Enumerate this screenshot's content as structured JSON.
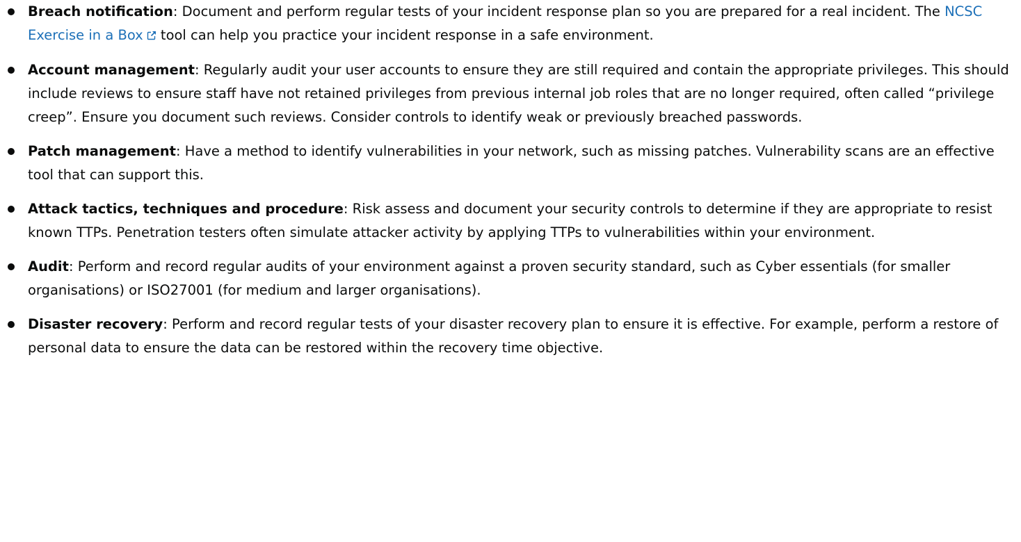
{
  "items": [
    {
      "term": "Breach notification",
      "sep": ": ",
      "text_before": "Document and perform regular tests of your incident response plan so you are prepared for a real incident. The ",
      "link_label": "NCSC Exercise in a Box",
      "link_icon": "external-link-icon",
      "text_after": " tool can help you practice your incident response in a safe environment."
    },
    {
      "term": "Account management",
      "sep": ": ",
      "text": "Regularly audit your user accounts to ensure they are still required and contain the appropriate privileges. This should include reviews to ensure staff have not retained privileges from previous internal job roles that are no longer required, often called “privilege creep”. Ensure you document such reviews. Consider controls to identify weak or previously breached passwords."
    },
    {
      "term": "Patch management",
      "sep": ": ",
      "text": "Have a method to identify vulnerabilities in your network, such as missing patches. Vulnerability scans are an effective tool that can support this."
    },
    {
      "term": "Attack tactics, techniques and procedure",
      "sep": ": ",
      "text": "Risk assess and document your security controls to determine if they are appropriate to resist known TTPs. Penetration testers often simulate attacker activity by applying TTPs to vulnerabilities within your environment."
    },
    {
      "term": "Audit",
      "sep": ": ",
      "text": "Perform and record regular audits of your environment against a proven security standard, such as Cyber essentials (for smaller organisations) or ISO27001 (for medium and larger organisations)."
    },
    {
      "term": "Disaster recovery",
      "sep": ": ",
      "text": "Perform and record regular tests of your disaster recovery plan to ensure it is effective. For example, perform a restore of personal data to ensure the data can be restored within the recovery time objective."
    }
  ],
  "colors": {
    "text": "#0b0c0c",
    "link": "#1d70b8",
    "background": "#ffffff"
  }
}
